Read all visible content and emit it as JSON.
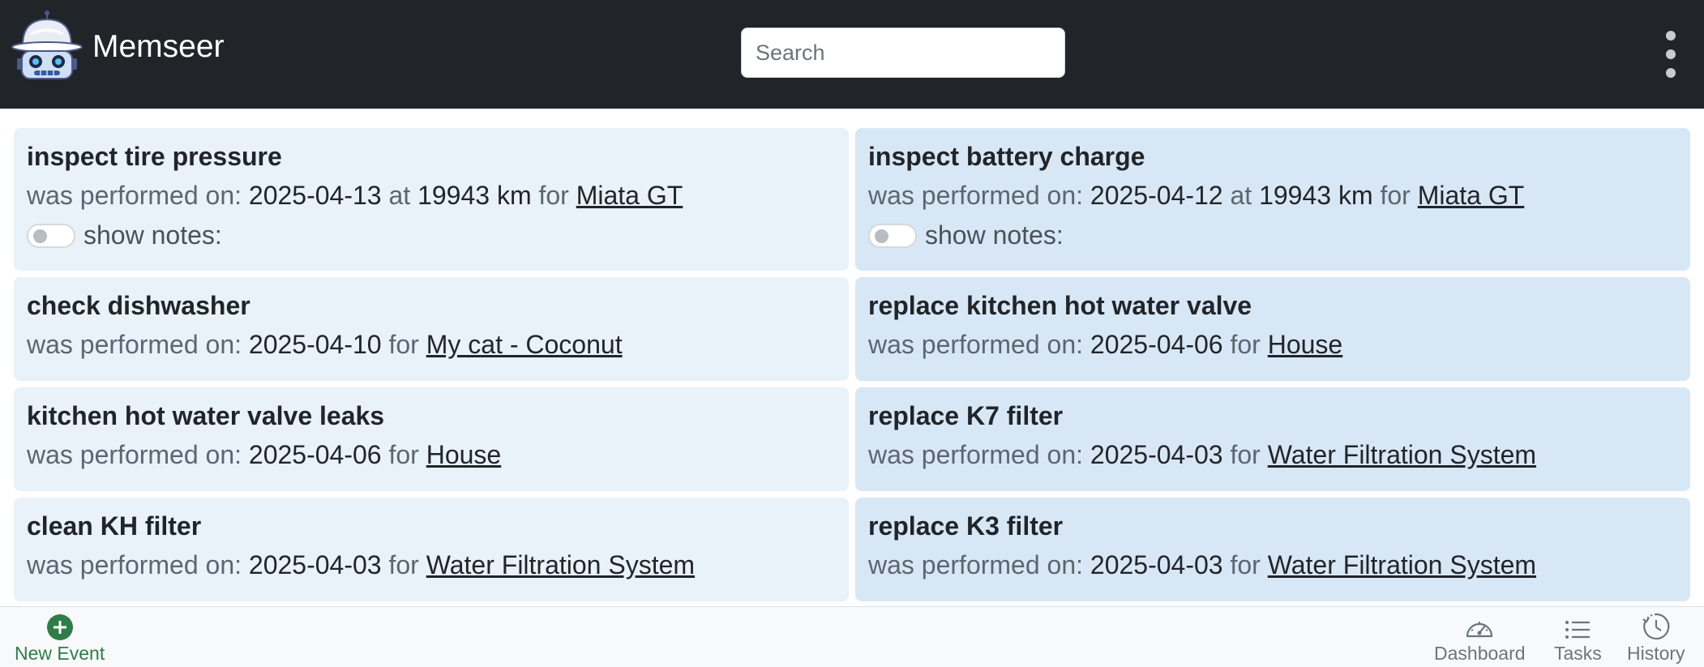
{
  "header": {
    "app_name": "Memseer",
    "logo_icon": "robot-logo-icon",
    "search_placeholder": "Search",
    "menu_icon": "kebab-menu-icon"
  },
  "events": [
    {
      "title": "inspect tire pressure",
      "performed_label": "was performed on:",
      "date": "2025-04-13",
      "at_label": "at",
      "mileage": "19943 km",
      "for_label": "for",
      "asset": "Miata GT",
      "notes_label": "show notes:",
      "notes_shown": false
    },
    {
      "title": "inspect battery charge",
      "performed_label": "was performed on:",
      "date": "2025-04-12",
      "at_label": "at",
      "mileage": "19943 km",
      "for_label": "for",
      "asset": "Miata GT",
      "notes_label": "show notes:",
      "notes_shown": false
    },
    {
      "title": "check dishwasher",
      "performed_label": "was performed on:",
      "date": "2025-04-10",
      "for_label": "for",
      "asset": "My cat - Coconut"
    },
    {
      "title": "replace kitchen hot water valve",
      "performed_label": "was performed on:",
      "date": "2025-04-06",
      "for_label": "for",
      "asset": "House"
    },
    {
      "title": "kitchen hot water valve leaks",
      "performed_label": "was performed on:",
      "date": "2025-04-06",
      "for_label": "for",
      "asset": "House"
    },
    {
      "title": "replace K7 filter",
      "performed_label": "was performed on:",
      "date": "2025-04-03",
      "for_label": "for",
      "asset": "Water Filtration System"
    },
    {
      "title": "clean KH filter",
      "performed_label": "was performed on:",
      "date": "2025-04-03",
      "for_label": "for",
      "asset": "Water Filtration System"
    },
    {
      "title": "replace K3 filter",
      "performed_label": "was performed on:",
      "date": "2025-04-03",
      "for_label": "for",
      "asset": "Water Filtration System"
    }
  ],
  "footer": {
    "new_event": {
      "label": "New Event",
      "icon": "plus-circle-icon",
      "color": "#2e7d48"
    },
    "dashboard": {
      "label": "Dashboard",
      "icon": "speedometer-icon"
    },
    "tasks": {
      "label": "Tasks",
      "icon": "list-icon"
    },
    "history": {
      "label": "History",
      "icon": "history-clock-icon"
    }
  },
  "colors": {
    "header_bg": "#212529",
    "card_left_bg": "#e9f1f9",
    "card_right_bg": "#d8e7f6"
  }
}
